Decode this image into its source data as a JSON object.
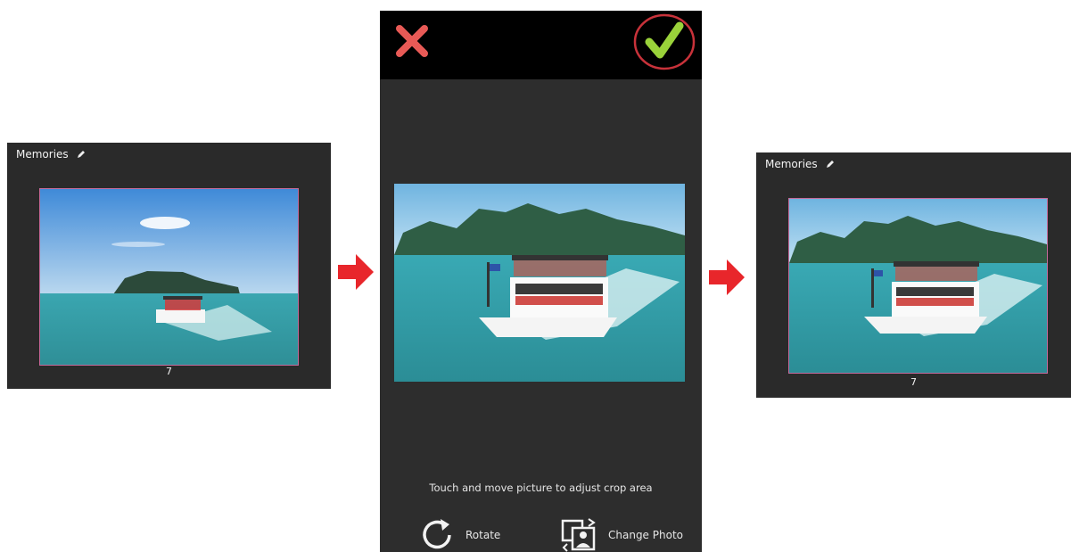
{
  "left_panel": {
    "title": "Memories",
    "page_number": "7"
  },
  "right_panel": {
    "title": "Memories",
    "page_number": "7"
  },
  "crop_screen": {
    "hint": "Touch and move picture to adjust crop area",
    "rotate_label": "Rotate",
    "change_photo_label": "Change Photo"
  },
  "colors": {
    "panel_bg": "#2a2a2a",
    "arrow": "#e8262b",
    "cancel": "#e85a56",
    "confirm": "#9ad23a",
    "highlight_circle": "#c8323a"
  },
  "icons": [
    "pencil-icon",
    "arrow-right-icon",
    "close-icon",
    "checkmark-icon",
    "rotate-icon",
    "change-photo-icon"
  ]
}
